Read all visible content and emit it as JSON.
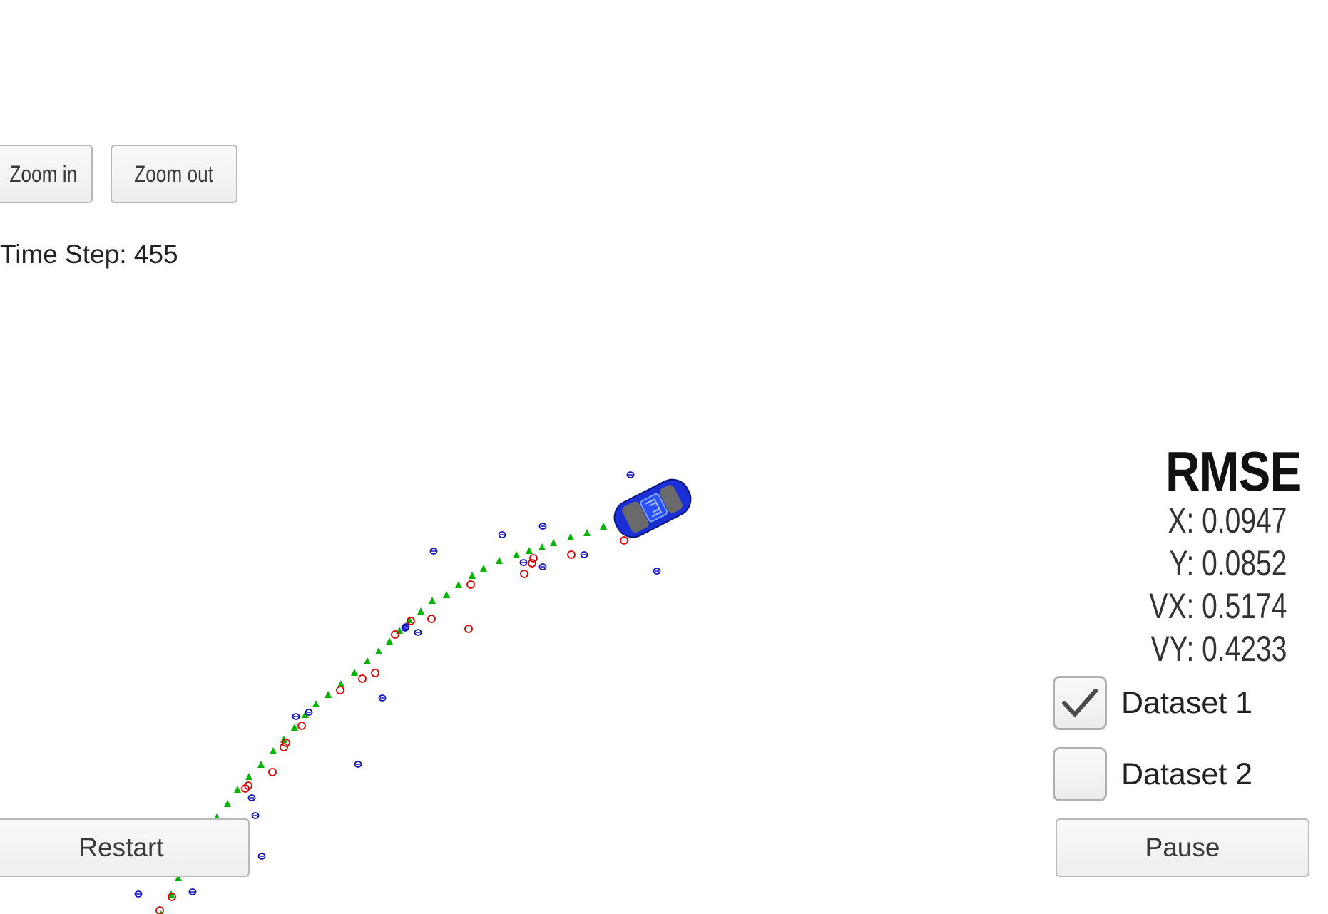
{
  "controls": {
    "zoom_in_label": "Zoom in",
    "zoom_out_label": "Zoom out",
    "restart_label": "Restart",
    "pause_label": "Pause"
  },
  "time_step": "Time Step: 455",
  "rmse": {
    "title": "RMSE",
    "x": "X: 0.0947",
    "y": "Y: 0.0852",
    "vx": "VX: 0.5174",
    "vy": "VY: 0.4233"
  },
  "datasets": [
    {
      "label": "Dataset 1",
      "checked": true
    },
    {
      "label": "Dataset 2",
      "checked": false
    }
  ],
  "colors": {
    "ground_truth": "#00b400",
    "lidar": "#e00000",
    "radar": "#1010c0",
    "car": "#1a2fd6"
  },
  "icons": [
    "car-icon",
    "check-icon"
  ]
}
